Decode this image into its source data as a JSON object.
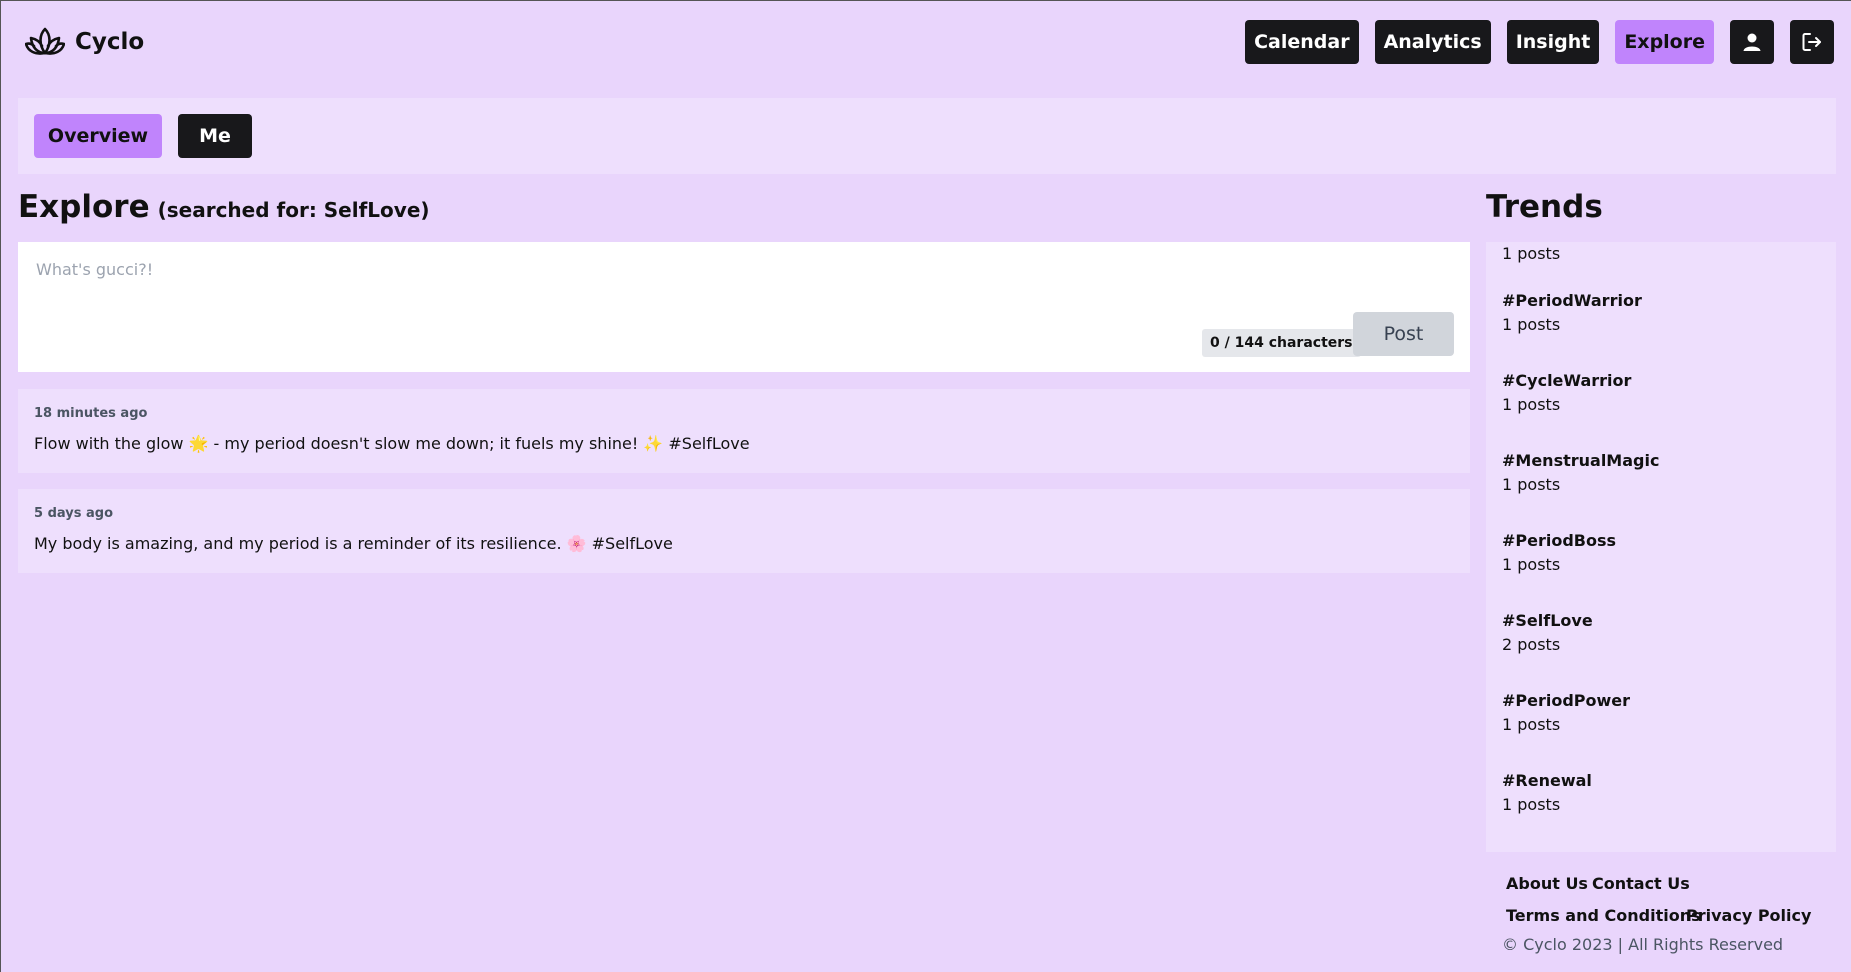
{
  "brand": {
    "name": "Cyclo",
    "logo_icon": "lotus-icon"
  },
  "nav": {
    "items": [
      {
        "label": "Calendar",
        "active": false
      },
      {
        "label": "Analytics",
        "active": false
      },
      {
        "label": "Insight",
        "active": false
      },
      {
        "label": "Explore",
        "active": true
      }
    ],
    "profile_icon": "user-icon",
    "logout_icon": "logout-icon"
  },
  "subnav": {
    "tabs": [
      {
        "label": "Overview",
        "active": true
      },
      {
        "label": "Me",
        "active": false
      }
    ]
  },
  "main": {
    "title": "Explore",
    "subtitle": "(searched for: SelfLove)",
    "composer": {
      "placeholder": "What's gucci?!",
      "value": "",
      "char_count": "0 / 144 characters",
      "post_label": "Post"
    },
    "posts": [
      {
        "time": "18 minutes ago",
        "text": "Flow with the glow 🌟 - my period doesn't slow me down; it fuels my shine! ✨ #SelfLove"
      },
      {
        "time": "5 days ago",
        "text": "My body is amazing, and my period is a reminder of its resilience. 🌸 #SelfLove"
      }
    ]
  },
  "trends": {
    "title": "Trends",
    "items": [
      {
        "tag": "",
        "count": "1 posts"
      },
      {
        "tag": "#PeriodWarrior",
        "count": "1 posts"
      },
      {
        "tag": "#CycleWarrior",
        "count": "1 posts"
      },
      {
        "tag": "#MenstrualMagic",
        "count": "1 posts"
      },
      {
        "tag": "#PeriodBoss",
        "count": "1 posts"
      },
      {
        "tag": "#SelfLove",
        "count": "2 posts"
      },
      {
        "tag": "#PeriodPower",
        "count": "1 posts"
      },
      {
        "tag": "#Renewal",
        "count": "1 posts"
      }
    ]
  },
  "footer": {
    "links": [
      "About Us",
      "Contact Us",
      "Terms and Conditions",
      "Privacy Policy"
    ],
    "copyright": "© Cyclo 2023 | All Rights Reserved"
  },
  "colors": {
    "background": "#e9d5fc",
    "panel": "#eedffd",
    "accent": "#c084fc",
    "dark_button": "#18181b"
  }
}
